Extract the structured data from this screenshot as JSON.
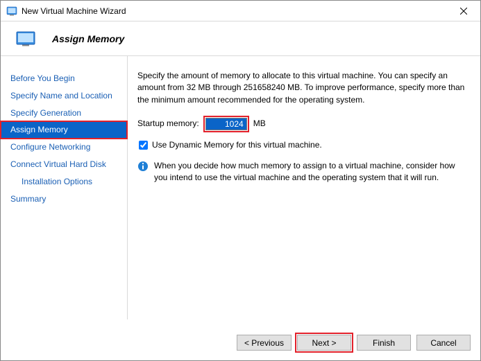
{
  "window": {
    "title": "New Virtual Machine Wizard"
  },
  "header": {
    "title": "Assign Memory"
  },
  "sidebar": {
    "items": [
      {
        "label": "Before You Begin"
      },
      {
        "label": "Specify Name and Location"
      },
      {
        "label": "Specify Generation"
      },
      {
        "label": "Assign Memory"
      },
      {
        "label": "Configure Networking"
      },
      {
        "label": "Connect Virtual Hard Disk"
      },
      {
        "label": "Installation Options"
      },
      {
        "label": "Summary"
      }
    ]
  },
  "main": {
    "intro": "Specify the amount of memory to allocate to this virtual machine. You can specify an amount from 32 MB through 251658240 MB. To improve performance, specify more than the minimum amount recommended for the operating system.",
    "memory_label": "Startup memory:",
    "memory_value": "1024",
    "memory_unit": "MB",
    "dynamic_checked": true,
    "dynamic_label": "Use Dynamic Memory for this virtual machine.",
    "info_text": "When you decide how much memory to assign to a virtual machine, consider how you intend to use the virtual machine and the operating system that it will run."
  },
  "buttons": {
    "previous": "< Previous",
    "next": "Next >",
    "finish": "Finish",
    "cancel": "Cancel"
  }
}
